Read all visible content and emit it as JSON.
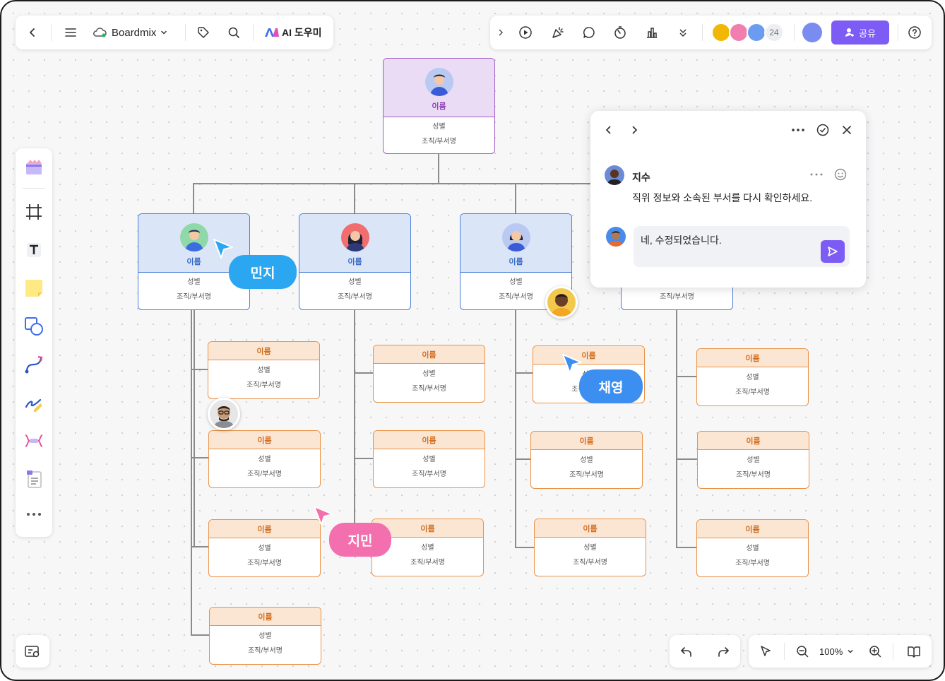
{
  "app": {
    "board_name": "Boardmix",
    "ai_label": "AI 도우미",
    "share_label": "공유",
    "collaborator_count": "24",
    "zoom": "100%",
    "accent": "#7c5cf5"
  },
  "org": {
    "top": {
      "name": "이름",
      "gender": "성별",
      "dept": "조직/부서명"
    },
    "managers": [
      {
        "name": "이름",
        "gender": "성별",
        "dept": "조직/부서명"
      },
      {
        "name": "이름",
        "gender": "성별",
        "dept": "조직/부서명"
      },
      {
        "name": "이름",
        "gender": "성별",
        "dept": "조직/부서명"
      },
      {
        "name": "이름",
        "gender": "성별",
        "dept": "조직/부서명"
      }
    ],
    "employees": [
      {
        "name": "이름",
        "gender": "성별",
        "dept": "조직/부서명"
      },
      {
        "name": "이름",
        "gender": "성별",
        "dept": "조직/부서명"
      },
      {
        "name": "이름",
        "gender": "성별",
        "dept": "조직/부서명"
      },
      {
        "name": "이름",
        "gender": "성별",
        "dept": "조직/부서명"
      },
      {
        "name": "이름",
        "gender": "성별",
        "dept": "조직/부서명"
      },
      {
        "name": "이름",
        "gender": "성별",
        "dept": "조직/부서명"
      },
      {
        "name": "이름",
        "gender": "성별",
        "dept": "조직/부서명"
      },
      {
        "name": "이름",
        "gender": "성별",
        "dept": "조직/부서명"
      },
      {
        "name": "이름",
        "gender": "성별",
        "dept": "조직/부서명"
      },
      {
        "name": "이름",
        "gender": "성별",
        "dept": "조직/부서명"
      },
      {
        "name": "이름",
        "gender": "성별",
        "dept": "조직/부서명"
      },
      {
        "name": "이름",
        "gender": "성별",
        "dept": "조직/부서명"
      },
      {
        "name": "이름",
        "gender": "성별",
        "dept": "조직/부서명"
      }
    ]
  },
  "cursors": {
    "minji": "민지",
    "chaeyoung": "채영",
    "jimin": "지민"
  },
  "comment": {
    "author": "지수",
    "text": "직위 정보와 소속된 부서를 다시 확인하세요.",
    "reply_value": "네, 수정되었습니다."
  }
}
